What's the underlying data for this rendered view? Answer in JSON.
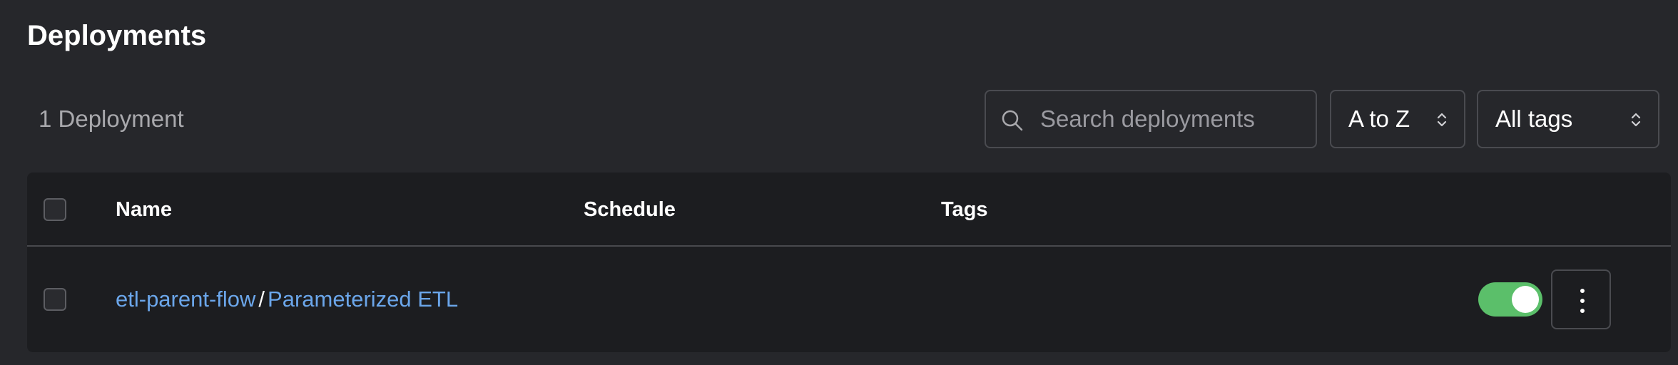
{
  "page": {
    "title": "Deployments",
    "count_label": "1 Deployment"
  },
  "toolbar": {
    "search_placeholder": "Search deployments",
    "search_value": "",
    "sort_value": "A to Z",
    "tags_value": "All tags"
  },
  "table": {
    "columns": [
      "Name",
      "Schedule",
      "Tags"
    ],
    "rows": [
      {
        "flow_name": "etl-parent-flow",
        "separator": "/",
        "deployment_name": "Parameterized ETL",
        "schedule": "",
        "tags": "",
        "selected": false,
        "active": true
      }
    ]
  },
  "colors": {
    "background": "#26272b",
    "table_background": "#1c1d20",
    "link": "#6ba6ea",
    "toggle_on": "#5bbf6a"
  },
  "icons": {
    "search": "search-icon",
    "sort_chevrons": "chevron-up-down-icon",
    "row_menu": "vertical-ellipsis-icon"
  }
}
